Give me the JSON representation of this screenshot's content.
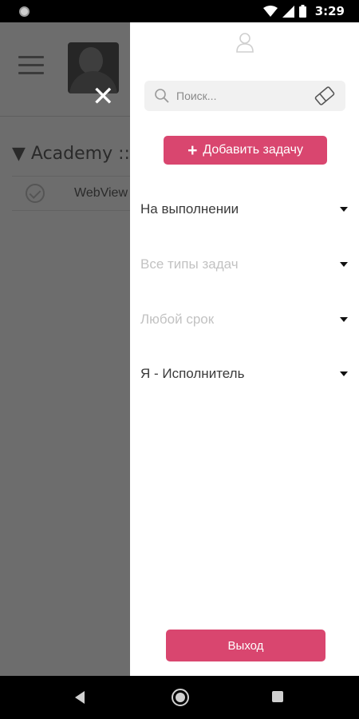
{
  "status_bar": {
    "time": "3:29",
    "icons": [
      "notification-dot-icon",
      "wifi-icon",
      "signal-icon",
      "battery-icon"
    ]
  },
  "background": {
    "group_title": "▼ Academy :: I",
    "row_text": "WebView"
  },
  "drawer": {
    "search": {
      "placeholder": "Поиск..."
    },
    "add_task_label": "Добавить задачу",
    "add_task_plus": "+",
    "filters": [
      {
        "label": "На выполнении",
        "muted": false
      },
      {
        "label": "Все типы задач",
        "muted": true
      },
      {
        "label": "Любой срок",
        "muted": true
      },
      {
        "label": "Я - Исполнитель",
        "muted": false
      }
    ],
    "logout_label": "Выход"
  },
  "colors": {
    "accent": "#d9466f",
    "overlay": "#6d6d6d"
  }
}
